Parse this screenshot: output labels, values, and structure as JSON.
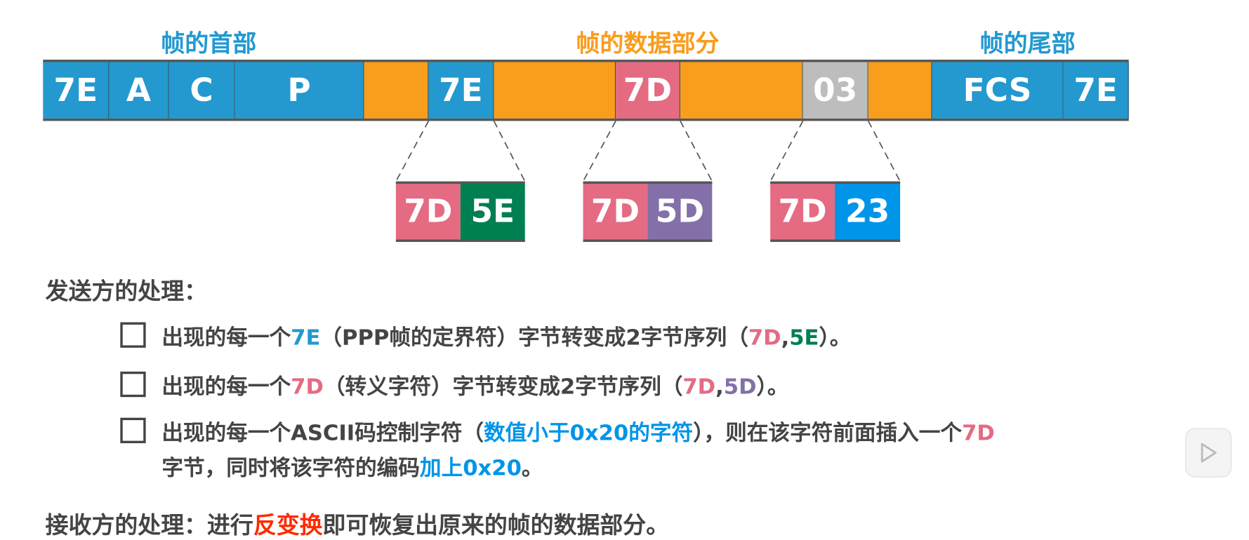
{
  "labels": {
    "header": "帧的首部",
    "data": "帧的数据部分",
    "trailer": "帧的尾部"
  },
  "frame": [
    {
      "text": "7E",
      "color": "#2399d0"
    },
    {
      "text": "A",
      "color": "#2399d0"
    },
    {
      "text": "C",
      "color": "#2399d0"
    },
    {
      "text": "P",
      "color": "#2399d0"
    },
    {
      "text": "",
      "color": "#f99d1c"
    },
    {
      "text": "7E",
      "color": "#2399d0"
    },
    {
      "text": "",
      "color": "#f99d1c"
    },
    {
      "text": "7D",
      "color": "#e46b82"
    },
    {
      "text": "",
      "color": "#f99d1c"
    },
    {
      "text": "03",
      "color": "#bdbdbd"
    },
    {
      "text": "",
      "color": "#f99d1c"
    },
    {
      "text": "FCS",
      "color": "#2399d0"
    },
    {
      "text": "7E",
      "color": "#2399d0"
    }
  ],
  "expansions": [
    {
      "a": "7D",
      "b": "5E",
      "b_color": "#008050"
    },
    {
      "a": "7D",
      "b": "5D",
      "b_color": "#8470a8"
    },
    {
      "a": "7D",
      "b": "23",
      "b_color": "#0095e8"
    }
  ],
  "sender": {
    "title": "发送方的处理：",
    "rule1": {
      "p1": "出现的每一个",
      "h1": "7E",
      "p2": "（PPP帧的定界符）字节转变成2字节序列（",
      "h2": "7D",
      ",": ",",
      "h3": "5E",
      "p3": "）。"
    },
    "rule2": {
      "p1": "出现的每一个",
      "h1": "7D",
      "p2": "（转义字符）字节转变成2字节序列（",
      "h2": "7D",
      ",": ",",
      "h3": "5D",
      "p3": "）。"
    },
    "rule3": {
      "p1": "出现的每一个ASCII码控制字符（",
      "h1": "数值小于0x20的字符",
      "p2": "），则在该字符前面插入一个",
      "h2": "7D",
      "l2p1": "字节，同时将该字符的编码",
      "h3": "加上0x20",
      "l2p2": "。"
    }
  },
  "receiver": {
    "p1": "接收方的处理：进行",
    "h1": "反变换",
    "p2": "即可恢复出原来的帧的数据部分。"
  },
  "colors": {
    "blue": "#2399d0",
    "orange": "#f99d1c",
    "pink": "#e46b82",
    "green": "#008050",
    "purple": "#8470a8",
    "bright_blue": "#0095e8",
    "red": "#ff2a00",
    "text": "#444444"
  }
}
